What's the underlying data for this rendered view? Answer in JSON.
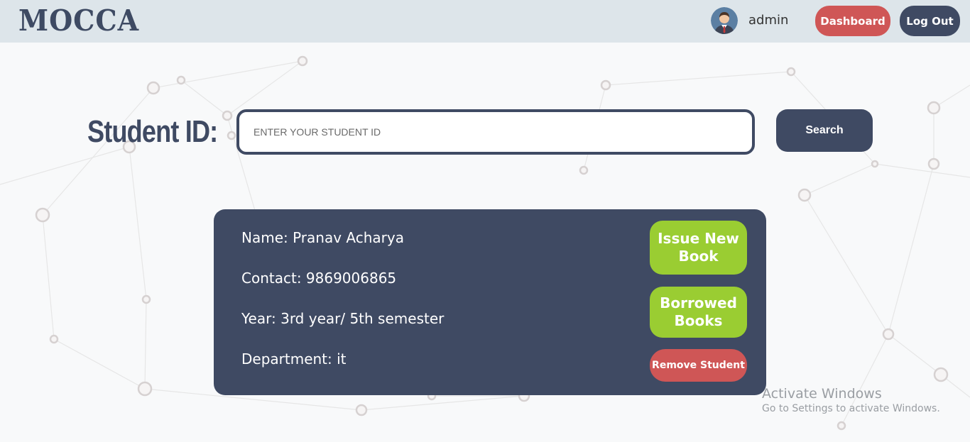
{
  "header": {
    "logo_text": "MOCCA",
    "username": "admin",
    "dashboard_label": "Dashboard",
    "logout_label": "Log Out"
  },
  "search": {
    "label": "Student ID:",
    "placeholder": "ENTER YOUR STUDENT ID",
    "value": "",
    "button_label": "Search"
  },
  "student": {
    "name": "Name: Pranav Acharya",
    "contact": "Contact: 9869006865",
    "year": "Year: 3rd year/ 5th semester",
    "department": "Department: it"
  },
  "actions": {
    "issue_line1": "Issue New",
    "issue_line2": "Book",
    "borrowed_line1": "Borrowed",
    "borrowed_line2": "Books",
    "remove_label": "Remove Student"
  },
  "watermark": {
    "title": "Activate Windows",
    "subtitle": "Go to Settings to activate Windows."
  },
  "colors": {
    "primary": "#3f4a63",
    "danger": "#cf5656",
    "success": "#9acd32",
    "topbar": "#dde5ea"
  }
}
